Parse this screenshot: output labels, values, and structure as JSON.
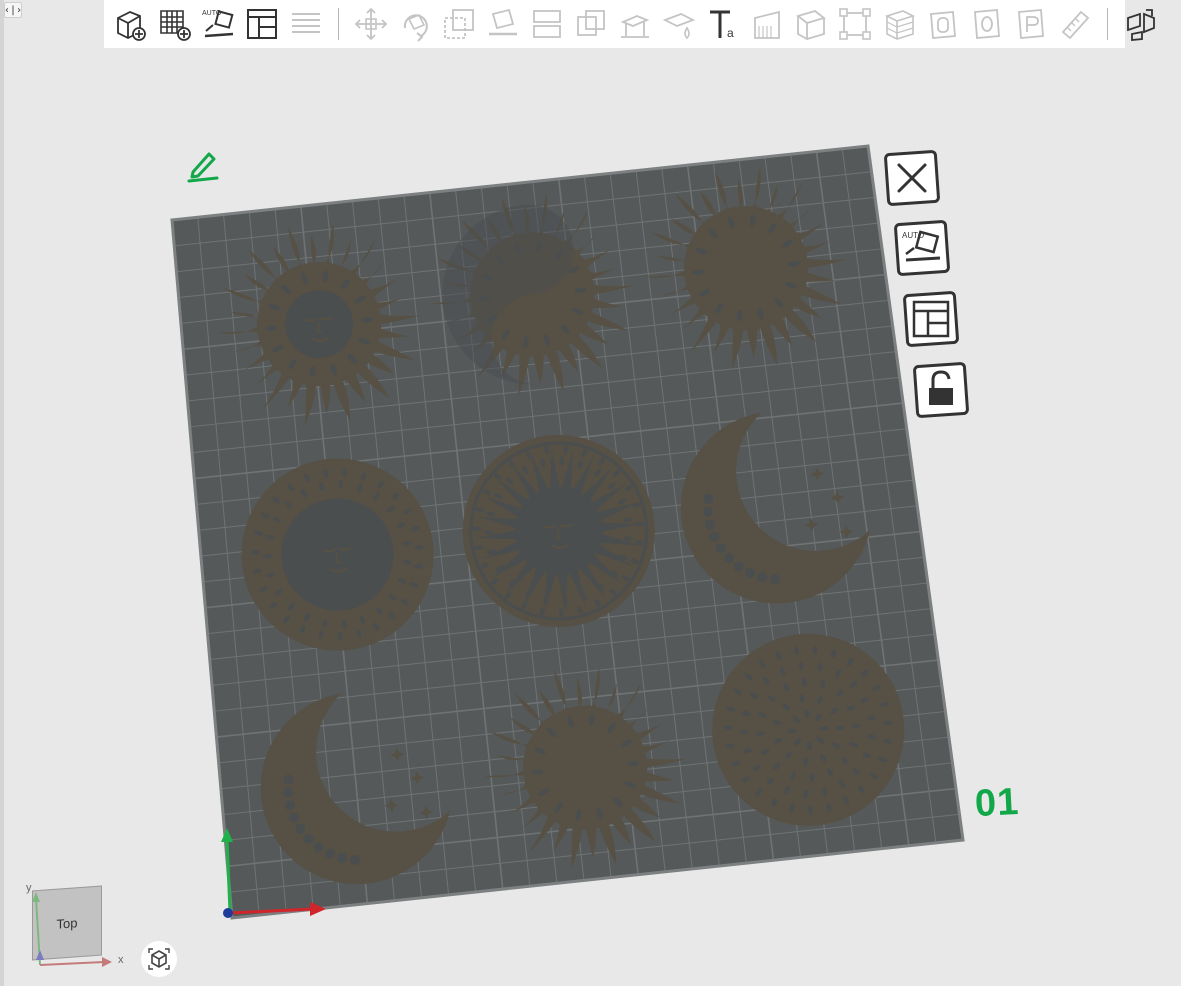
{
  "panel_toggle": "‹|›",
  "toolbar": {
    "groups": [
      [
        "add-model",
        "add-plate",
        "auto-orient",
        "arrange",
        "stack"
      ],
      [
        "move",
        "rotate",
        "scale",
        "lay-on-face",
        "split",
        "boolean",
        "support-paint",
        "seam-paint",
        "text",
        "variable-layer",
        "cut",
        "mesh-repair",
        "assembly",
        "layer",
        "emboss-o",
        "emboss-p",
        "measure"
      ],
      [
        "explode"
      ]
    ],
    "enabled": [
      "add-model",
      "add-plate",
      "auto-orient",
      "arrange",
      "explode",
      "text"
    ]
  },
  "plate": {
    "number_label": "01",
    "label_color": "#12a84a",
    "bed_color": "#55595a",
    "grid_color": "#6f7374",
    "model_color": "#575044",
    "side_buttons": [
      "close-plate",
      "auto-orient-plate",
      "arrange-plate",
      "lock-plate"
    ],
    "models": [
      "sun-face-mandala",
      "sun-moon-yin-yang",
      "sun-flower-swirl",
      "sun-face-lace",
      "sun-face-ring",
      "moon-face-crescent",
      "moon-crescent-stars",
      "sun-mandala-flowers",
      "circle-mandala-lace"
    ]
  },
  "view_cube": {
    "face_label": "Top",
    "axis_x": "x",
    "axis_y": "y"
  },
  "axes": {
    "x_color": "#d0262b",
    "y_color": "#1fb24a",
    "z_color": "#1e3a9a"
  }
}
